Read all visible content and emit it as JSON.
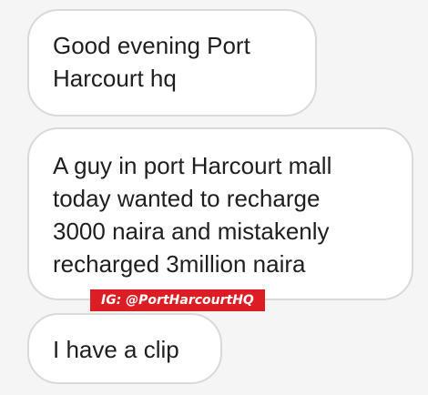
{
  "messages": [
    {
      "lines": [
        "Good evening Port",
        "Harcourt hq"
      ]
    },
    {
      "lines": [
        "A guy in port Harcourt mall",
        "today wanted to recharge",
        "3000 naira and mistakenly",
        "recharged 3million naira"
      ]
    },
    {
      "lines": [
        "I have a clip"
      ]
    }
  ],
  "watermark": {
    "text": "IG: @PortHarcourtHQ",
    "color": "#dc1e24"
  }
}
